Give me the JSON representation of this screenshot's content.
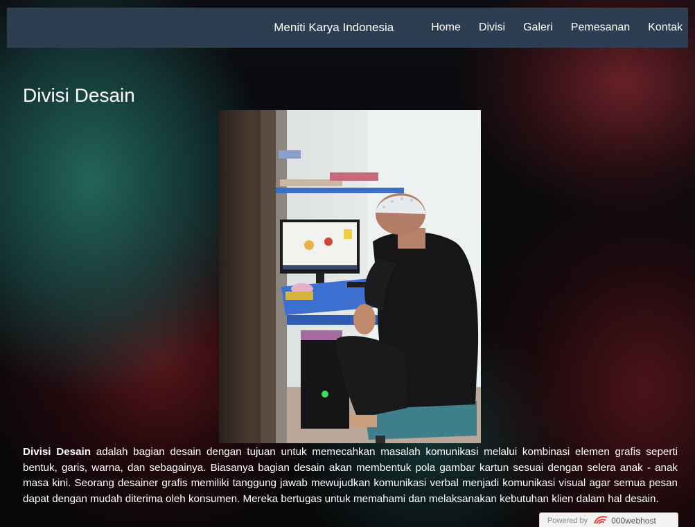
{
  "navbar": {
    "brand": "Meniti Karya Indonesia",
    "items": [
      {
        "label": "Home"
      },
      {
        "label": "Divisi"
      },
      {
        "label": "Galeri"
      },
      {
        "label": "Pemesanan"
      },
      {
        "label": "Kontak"
      }
    ]
  },
  "page": {
    "title": "Divisi Desain",
    "photo_icon": "photo-of-designer-at-computer"
  },
  "description": {
    "lead": "Divisi Desain",
    "body": " adalah bagian desain dengan tujuan untuk memecahkan masalah komunikasi melalui kombinasi elemen grafis seperti bentuk, garis, warna, dan sebagainya. Biasanya bagian desain akan membentuk pola gambar kartun sesuai dengan selera anak - anak masa kini. Seorang desainer grafis memiliki tanggung jawab mewujudkan komunikasi verbal menjadi komunikasi visual agar semua pesan dapat dengan mudah diterima oleh konsumen. Mereka bertugas untuk memahami dan melaksanakan kebutuhan klien dalam hal desain."
  },
  "footer": {
    "powered_by": "Powered by",
    "host_name": "000webhost",
    "logo_icon": "000webhost-logo-icon"
  },
  "colors": {
    "navbar_bg": "#2c3e50",
    "text": "#ffffff",
    "badge_bg": "#f2f2f2",
    "logo_red": "#e8413c"
  }
}
